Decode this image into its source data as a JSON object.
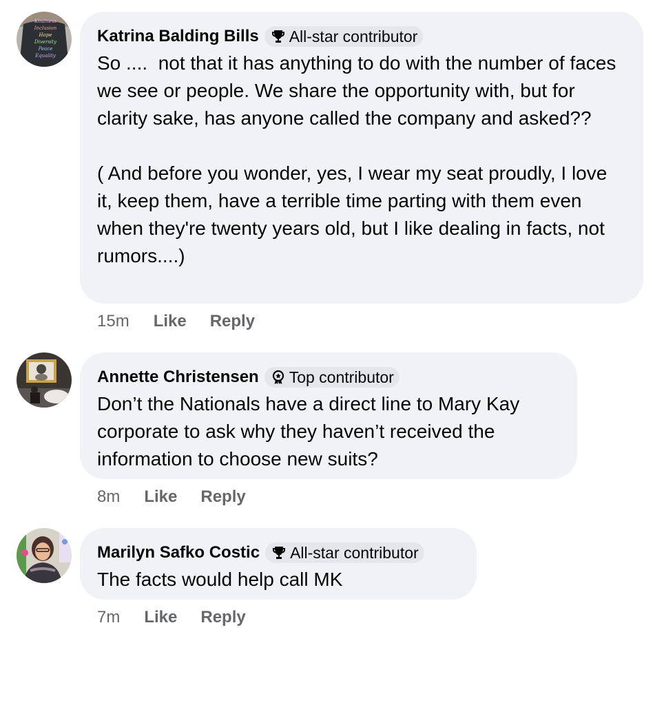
{
  "comments": [
    {
      "author": "Katrina Balding Bills",
      "badge": {
        "label": "All-star contributor",
        "icon": "trophy-icon"
      },
      "text": "So ....  not that it has anything to do with the number of faces we see or people. We share the opportunity with, but for clarity sake, has anyone called the company and asked??\n\n( And before you wonder, yes, I wear my seat proudly, I love it, keep them, have a terrible time parting with them even when they're twenty years old, but I like dealing in facts, not rumors....)",
      "avatar_text": [
        "Kindness",
        "Inclusion",
        "Hope",
        "Diversity",
        "Peace",
        "Equality"
      ],
      "time": "15m",
      "like": "Like",
      "reply": "Reply"
    },
    {
      "author": "Annette Christensen",
      "badge": {
        "label": "Top contributor",
        "icon": "medal-icon"
      },
      "text": "Don’t the Nationals have a direct line to Mary Kay corporate to ask why they haven’t received the information to choose new suits?",
      "time": "8m",
      "like": "Like",
      "reply": "Reply"
    },
    {
      "author": "Marilyn Safko Costic",
      "badge": {
        "label": "All-star contributor",
        "icon": "trophy-icon"
      },
      "text": "The facts would help call MK",
      "time": "7m",
      "like": "Like",
      "reply": "Reply"
    }
  ],
  "colors": {
    "bubble": "#f0f2f5",
    "badge": "#e4e6eb",
    "secondary_text": "#65676b",
    "primary_text": "#050505"
  }
}
